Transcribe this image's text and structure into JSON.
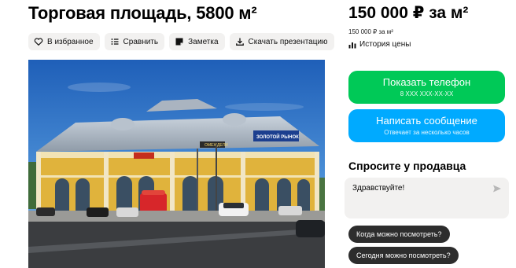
{
  "listing": {
    "title": "Торговая площадь, 5800 м²"
  },
  "actions": [
    {
      "label": "В избранное",
      "icon": "heart-icon"
    },
    {
      "label": "Сравнить",
      "icon": "compare-icon"
    },
    {
      "label": "Заметка",
      "icon": "note-icon"
    },
    {
      "label": "Скачать презентацию",
      "icon": "download-icon"
    }
  ],
  "photo": {
    "sign_text": "ЗОЛОТОЙ РЫНОК",
    "shop_sign": "ОМЕЖДЕЛИ"
  },
  "pricing": {
    "price": "150 000 ₽ за м²",
    "sub": "150 000 ₽ за м²",
    "history_label": "История цены"
  },
  "contact": {
    "phone_label": "Показать телефон",
    "phone_mask": "8 XXX XXX-XX-XX",
    "message_label": "Написать сообщение",
    "message_sub": "Отвечает за несколько часов"
  },
  "ask": {
    "title": "Спросите у продавца",
    "message_value": "Здравствуйте!",
    "quick_questions": [
      "Когда можно посмотреть?",
      "Сегодня можно посмотреть?"
    ]
  },
  "colors": {
    "phone_button": "#00c957",
    "message_button": "#00aaff",
    "chip_background": "#f2f1f0",
    "question_chip": "#2d2d2d"
  }
}
